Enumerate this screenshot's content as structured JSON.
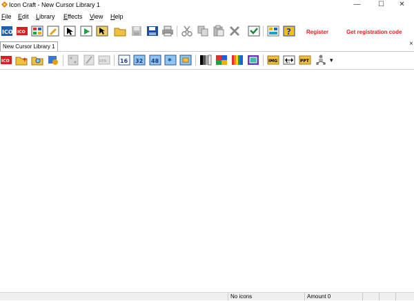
{
  "window": {
    "title": "Icon Craft - New Cursor Library 1",
    "controls": {
      "minimize": "—",
      "maximize": "☐",
      "close": "✕"
    }
  },
  "menu": {
    "items": [
      {
        "label": "File",
        "accel": "F",
        "rest": "ile"
      },
      {
        "label": "Edit",
        "accel": "E",
        "rest": "dit"
      },
      {
        "label": "Library",
        "accel": "L",
        "rest": "ibrary"
      },
      {
        "label": "Effects",
        "accel": "E",
        "rest": "ffects"
      },
      {
        "label": "View",
        "accel": "V",
        "rest": "iew"
      },
      {
        "label": "Help",
        "accel": "H",
        "rest": "elp"
      }
    ]
  },
  "toolbar1": {
    "register": "Register",
    "get_code": "Get registration code",
    "accent": "#e02020"
  },
  "tabs": [
    {
      "label": "New Cursor Library 1"
    }
  ],
  "toolbar2": {
    "size_16": "16",
    "size_32": "32",
    "size_48": "48",
    "img": "IMG",
    "ppt": "PPT",
    "dropdown_arrow": "▾"
  },
  "status": {
    "icons": "No icons",
    "amount": "Amount 0"
  }
}
